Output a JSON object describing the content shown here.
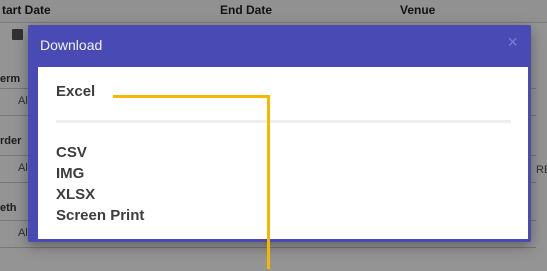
{
  "background": {
    "columns": {
      "start": "tart Date",
      "end": "End Date",
      "venue": "Venue"
    },
    "labels": [
      "erm",
      "rder",
      "eth"
    ],
    "selects": [
      "All",
      "All",
      "All"
    ],
    "right_text": "RE"
  },
  "modal": {
    "title": "Download",
    "close": "×",
    "options": {
      "excel": "Excel",
      "csv": "CSV",
      "img": "IMG",
      "xlsx": "XLSX",
      "print": "Screen Print"
    }
  },
  "colors": {
    "modal_header": "#4a4ab4",
    "annotation_line": "#f5b800"
  }
}
